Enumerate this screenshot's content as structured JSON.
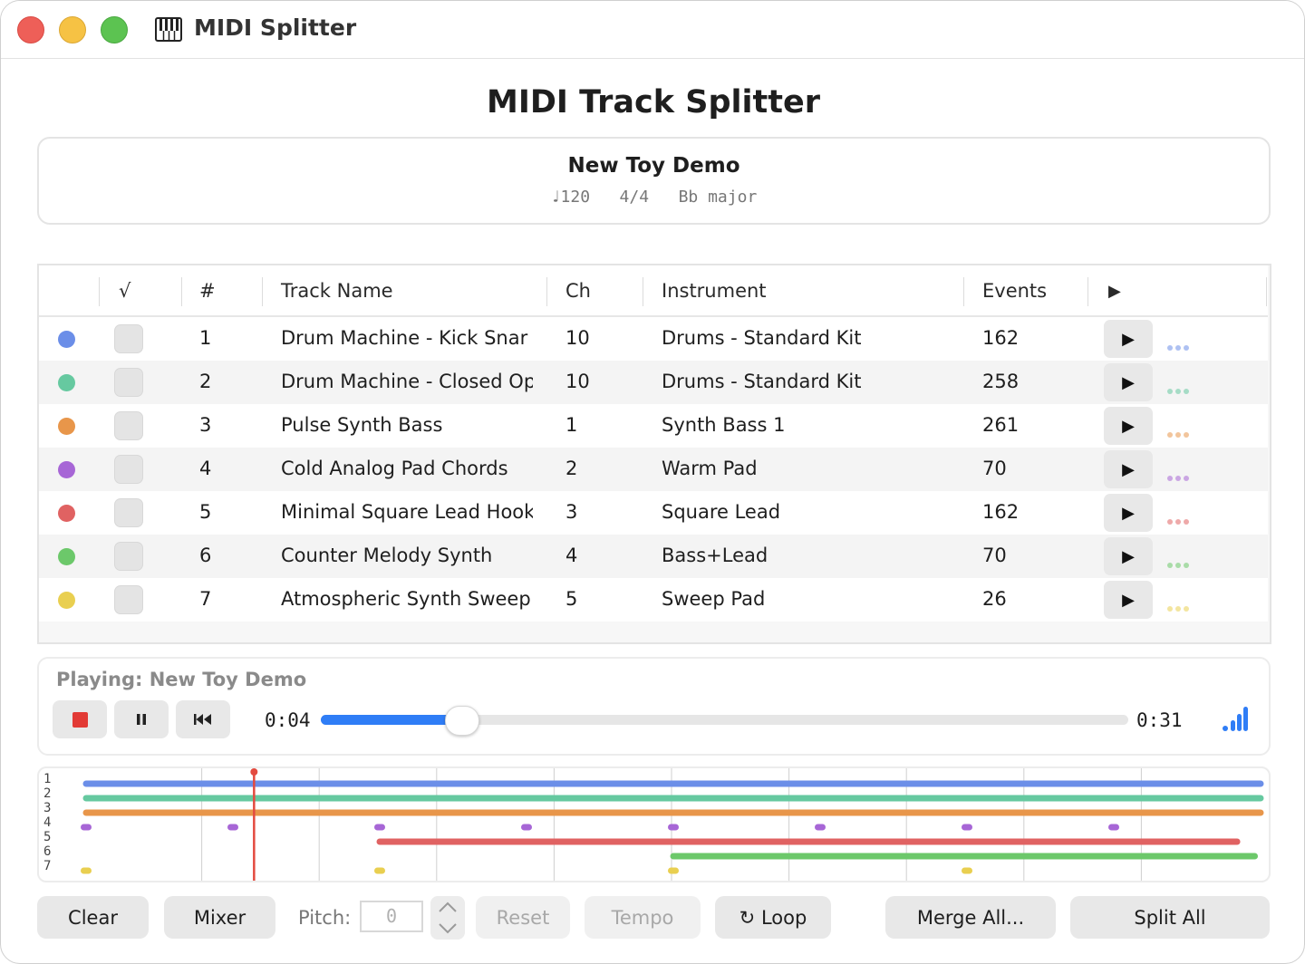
{
  "window": {
    "app_title": "MIDI Splitter",
    "app_icon": "piano-icon"
  },
  "page_title": "MIDI Track Splitter",
  "song": {
    "name": "New Toy Demo",
    "meta": "♩120   4/4   Bb major"
  },
  "table": {
    "headers": {
      "check": "√",
      "num": "#",
      "name": "Track Name",
      "ch": "Ch",
      "instrument": "Instrument",
      "events": "Events",
      "play": "▶"
    },
    "rows": [
      {
        "num": "1",
        "name": "Drum Machine - Kick Snar",
        "ch": "10",
        "instrument": "Drums - Standard Kit",
        "events": "162",
        "color": "#6b8ee8",
        "play": "▶"
      },
      {
        "num": "2",
        "name": "Drum Machine - Closed Op",
        "ch": "10",
        "instrument": "Drums - Standard Kit",
        "events": "258",
        "color": "#66c9a0",
        "play": "▶"
      },
      {
        "num": "3",
        "name": "Pulse Synth Bass",
        "ch": "1",
        "instrument": "Synth Bass 1",
        "events": "261",
        "color": "#e8964a",
        "play": "▶"
      },
      {
        "num": "4",
        "name": "Cold Analog Pad Chords",
        "ch": "2",
        "instrument": "Warm Pad",
        "events": "70",
        "color": "#a766d6",
        "play": "▶"
      },
      {
        "num": "5",
        "name": "Minimal Square Lead Hook",
        "ch": "3",
        "instrument": "Square Lead",
        "events": "162",
        "color": "#e06262",
        "play": "▶"
      },
      {
        "num": "6",
        "name": "Counter Melody Synth",
        "ch": "4",
        "instrument": "Bass+Lead",
        "events": "70",
        "color": "#6cc86a",
        "play": "▶"
      },
      {
        "num": "7",
        "name": "Atmospheric Synth Sweep",
        "ch": "5",
        "instrument": "Sweep Pad",
        "events": "26",
        "color": "#e9cf50",
        "play": "▶"
      }
    ]
  },
  "player": {
    "playing_label": "Playing: New Toy Demo",
    "elapsed": "0:04",
    "total": "0:31",
    "progress": 0.16,
    "accent": "#2f7df6"
  },
  "timeline": {
    "lane_labels": [
      "1",
      "2",
      "3",
      "4",
      "5",
      "6",
      "7"
    ],
    "playhead": 0.143,
    "accent": "#e34a3f"
  },
  "toolbar": {
    "clear": "Clear",
    "mixer": "Mixer",
    "pitch_label": "Pitch:",
    "pitch_value": "0",
    "reset": "Reset",
    "tempo": "Tempo",
    "loop": "↻ Loop",
    "merge_all": "Merge All...",
    "split_all": "Split All"
  }
}
